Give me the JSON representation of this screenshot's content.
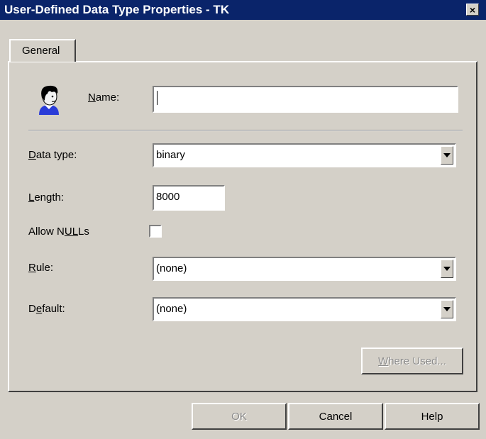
{
  "window": {
    "title": "User-Defined Data Type Properties - TK",
    "close_label": "×"
  },
  "tabs": [
    {
      "label": "General"
    }
  ],
  "form": {
    "name_label": "Name:",
    "name_value": "",
    "data_type_label": "Data type:",
    "data_type_value": "binary",
    "length_label": "Length:",
    "length_value": "8000",
    "allow_nulls_label": "Allow NULLs",
    "allow_nulls_checked": false,
    "rule_label": "Rule:",
    "rule_value": "(none)",
    "default_label": "Default:",
    "default_value": "(none)"
  },
  "buttons": {
    "where_used": "Where Used...",
    "ok": "OK",
    "cancel": "Cancel",
    "help": "Help"
  },
  "colors": {
    "titlebar": "#0a246a",
    "face": "#d4d0c8",
    "disabled_text": "#8a8a8a"
  },
  "icons": {
    "datatype": "person-icon",
    "close": "close-icon",
    "dropdown": "chevron-down-icon"
  }
}
